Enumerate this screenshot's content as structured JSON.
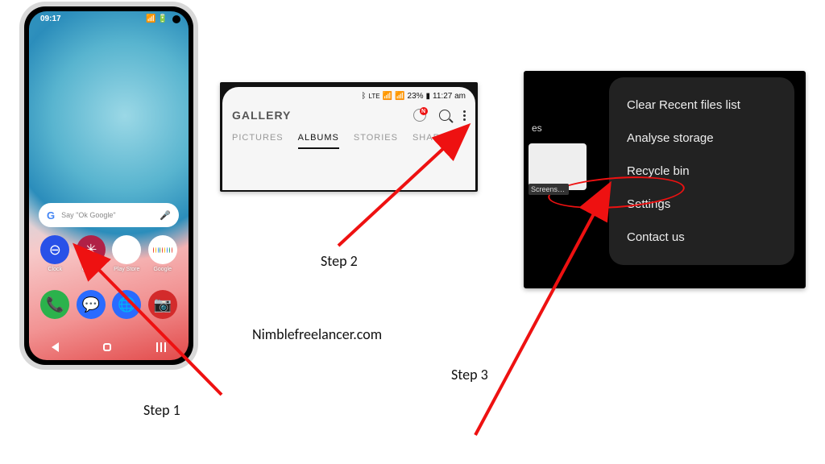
{
  "labels": {
    "step1": "Step 1",
    "step2": "Step 2",
    "step3": "Step 3",
    "site": "Nimblefreelancer.com"
  },
  "phone": {
    "time": "09:17",
    "search_placeholder": "Say \"Ok Google\"",
    "apps": {
      "clock": "Clock",
      "gallery": "Gallery",
      "play": "Play Store",
      "google": "Google"
    }
  },
  "gallery": {
    "status": {
      "battery": "23%",
      "time": "11:27 am"
    },
    "title": "GALLERY",
    "notif_badge": "N",
    "tabs": {
      "pictures": "PICTURES",
      "albums": "ALBUMS",
      "stories": "STORIES",
      "shared": "SHARED"
    }
  },
  "menu": {
    "bg_label_left": "es",
    "bg_label_thumb": "Screens…",
    "items": {
      "clear": "Clear Recent files list",
      "analyse": "Analyse storage",
      "recycle": "Recycle bin",
      "settings": "Settings",
      "contact": "Contact us"
    }
  }
}
